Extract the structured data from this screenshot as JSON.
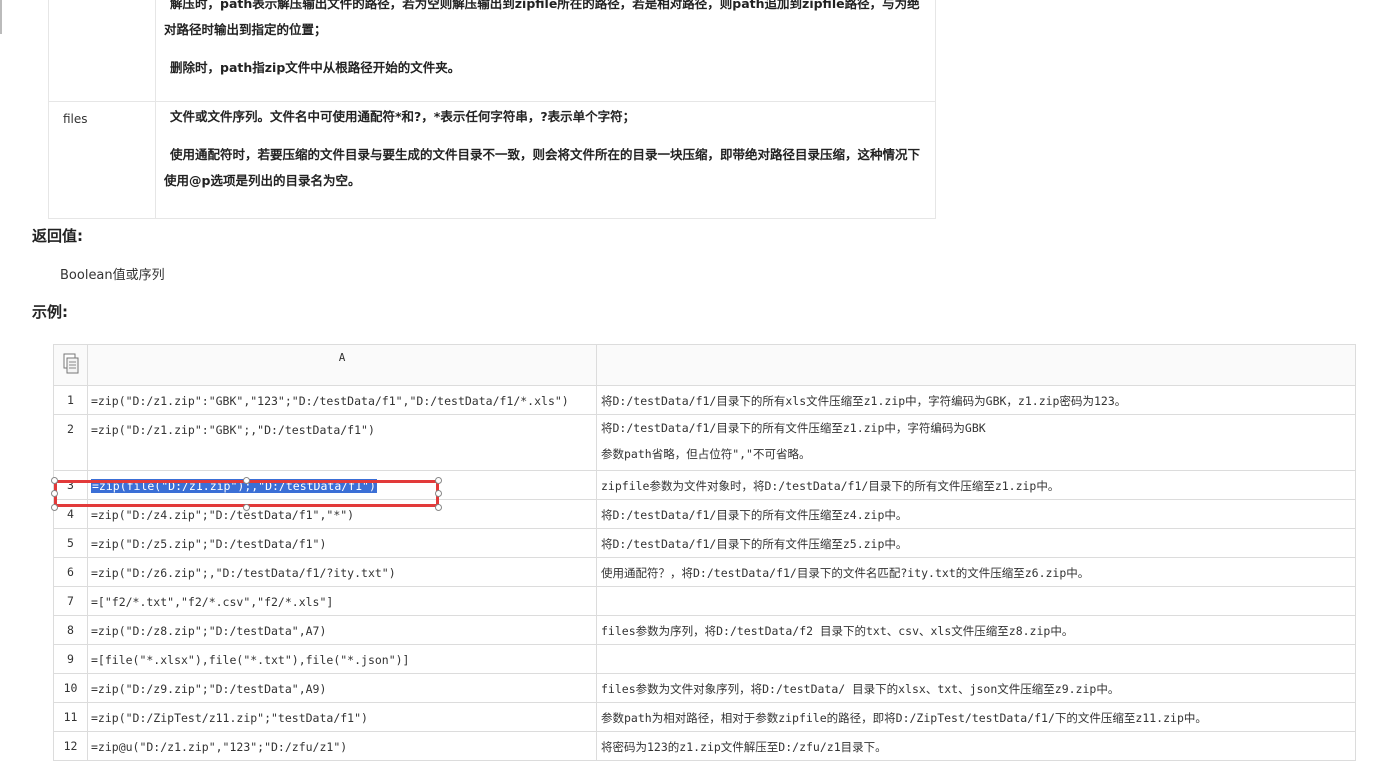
{
  "params": [
    {
      "name": "",
      "desc": [
        "解压时，path表示解压输出文件的路径，若为空则解压输出到zipfile所在的路径，若是相对路径，则path追加到zipfile路径，与为绝对路径时输出到指定的位置；",
        "删除时，path指zip文件中从根路径开始的文件夹。"
      ]
    },
    {
      "name": "files",
      "desc": [
        "文件或文件序列。文件名中可使用通配符*和?，*表示任何字符串，?表示单个字符；",
        "使用通配符时，若要压缩的文件目录与要生成的文件目录不一致，则会将文件所在的目录一块压缩，即带绝对路径目录压缩，这种情况下使用@p选项是列出的目录名为空。"
      ]
    }
  ],
  "return_title": "返回值:",
  "return_value": "Boolean值或序列",
  "example_title": "示例:",
  "grid": {
    "col_a_header": "A",
    "col_b_header": "",
    "selected_row": 3,
    "rows": [
      {
        "n": "1",
        "a": "=zip(\"D:/z1.zip\":\"GBK\",\"123\";\"D:/testData/f1\",\"D:/testData/f1/*.xls\")",
        "b": "将D:/testData/f1/目录下的所有xls文件压缩至z1.zip中，字符编码为GBK，z1.zip密码为123。"
      },
      {
        "n": "2",
        "a": "=zip(\"D:/z1.zip\":\"GBK\";,\"D:/testData/f1\")",
        "b": "将D:/testData/f1/目录下的所有文件压缩至z1.zip中，字符编码为GBK",
        "b2": "参数path省略，但占位符\",\"不可省略。"
      },
      {
        "n": "3",
        "a": "=zip(file(\"D:/z1.zip\");,\"D:/testData/f1\")",
        "b": "zipfile参数为文件对象时，将D:/testData/f1/目录下的所有文件压缩至z1.zip中。"
      },
      {
        "n": "4",
        "a": "=zip(\"D:/z4.zip\";\"D:/testData/f1\",\"*\")",
        "b": "将D:/testData/f1/目录下的所有文件压缩至z4.zip中。"
      },
      {
        "n": "5",
        "a": "=zip(\"D:/z5.zip\";\"D:/testData/f1\")",
        "b": "将D:/testData/f1/目录下的所有文件压缩至z5.zip中。"
      },
      {
        "n": "6",
        "a": "=zip(\"D:/z6.zip\";,\"D:/testData/f1/?ity.txt\")",
        "b": "使用通配符？，将D:/testData/f1/目录下的文件名匹配?ity.txt的文件压缩至z6.zip中。"
      },
      {
        "n": "7",
        "a": "=[\"f2/*.txt\",\"f2/*.csv\",\"f2/*.xls\"]",
        "b": ""
      },
      {
        "n": "8",
        "a": "=zip(\"D:/z8.zip\";\"D:/testData\",A7)",
        "b": "files参数为序列，将D:/testData/f2 目录下的txt、csv、xls文件压缩至z8.zip中。"
      },
      {
        "n": "9",
        "a": "=[file(\"*.xlsx\"),file(\"*.txt\"),file(\"*.json\")]",
        "b": ""
      },
      {
        "n": "10",
        "a": "=zip(\"D:/z9.zip\";\"D:/testData\",A9)",
        "b": "files参数为文件对象序列，将D:/testData/ 目录下的xlsx、txt、json文件压缩至z9.zip中。"
      },
      {
        "n": "11",
        "a": "=zip(\"D:/ZipTest/z11.zip\";\"testData/f1\")",
        "b": "参数path为相对路径，相对于参数zipfile的路径，即将D:/ZipTest/testData/f1/下的文件压缩至z11.zip中。"
      },
      {
        "n": "12",
        "a": "=zip@u(\"D:/z1.zip\",\"123\";\"D:/zfu/z1\")",
        "b": "将密码为123的z1.zip文件解压至D:/zfu/z1目录下。"
      }
    ]
  }
}
